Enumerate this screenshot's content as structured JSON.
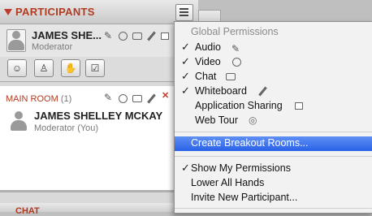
{
  "panel": {
    "title": "PARTICIPANTS"
  },
  "me": {
    "name": "JAMES SHE...",
    "role": "Moderator"
  },
  "toolbar": {
    "buttons": [
      "emoticon",
      "profile",
      "raise-hand",
      "checkmark"
    ]
  },
  "room": {
    "title": "MAIN ROOM",
    "count": "(1)",
    "participant": {
      "name": "JAMES SHELLEY MCKAY",
      "role": "Moderator (You)"
    }
  },
  "chat": {
    "title": "CHAT"
  },
  "menu": {
    "header": "Global Permissions",
    "permissions": [
      {
        "label": "Audio",
        "checked": true,
        "icon": "microphone-icon"
      },
      {
        "label": "Video",
        "checked": true,
        "icon": "webcam-icon"
      },
      {
        "label": "Chat",
        "checked": true,
        "icon": "chat-bubble-icon"
      },
      {
        "label": "Whiteboard",
        "checked": true,
        "icon": "pencil-icon"
      },
      {
        "label": "Application Sharing",
        "checked": false,
        "icon": "app-share-icon"
      },
      {
        "label": "Web Tour",
        "checked": false,
        "icon": "globe-icon"
      }
    ],
    "breakout": "Create Breakout Rooms...",
    "show_permissions": "Show My Permissions",
    "lower_hands": "Lower All Hands",
    "invite": "Invite New Participant...",
    "check_glyph": "✓"
  }
}
